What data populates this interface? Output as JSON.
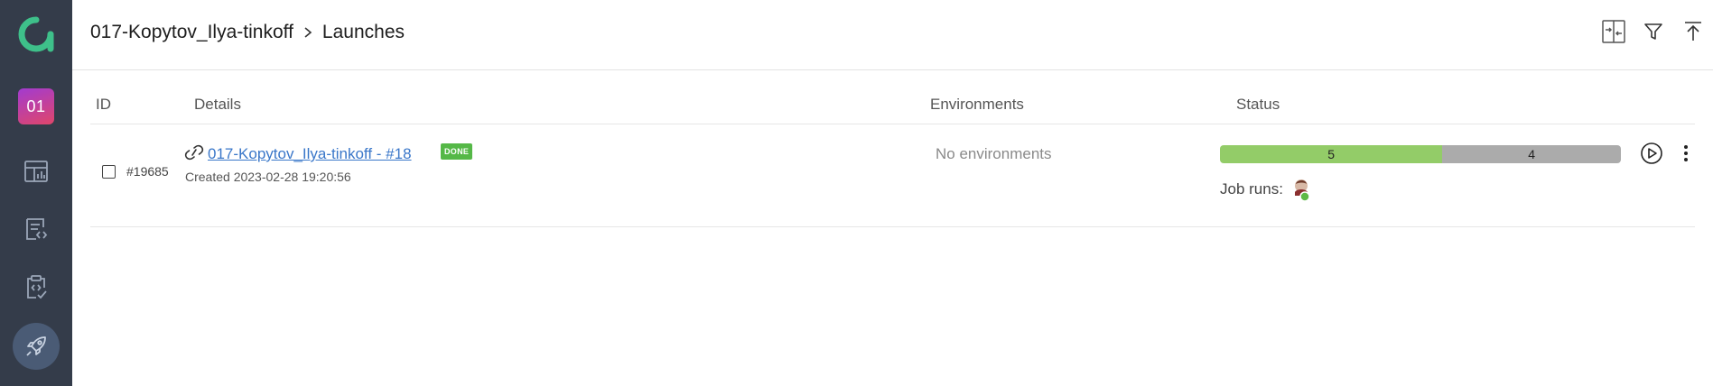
{
  "sidebar": {
    "logo_icon": "allure-logo-icon",
    "project_badge": "01",
    "items": [
      {
        "name": "dashboards",
        "icon": "dashboard-icon"
      },
      {
        "name": "test-cases",
        "icon": "test-cases-icon"
      },
      {
        "name": "test-plans",
        "icon": "clipboard-check-icon"
      },
      {
        "name": "launches",
        "icon": "rocket-icon",
        "active": true
      }
    ]
  },
  "header": {
    "breadcrumb": {
      "project": "017-Kopytov_Ilya-tinkoff",
      "page": "Launches"
    },
    "tools": [
      "merge-icon",
      "filter-icon",
      "upload-icon"
    ]
  },
  "table": {
    "columns": {
      "id": "ID",
      "details": "Details",
      "environments": "Environments",
      "status": "Status"
    },
    "rows": [
      {
        "id": "#19685",
        "name": "017-Kopytov_Ilya-tinkoff - #18",
        "badge": "DONE",
        "created": "Created 2023-02-28 19:20:56",
        "environments": "No environments",
        "status": {
          "passed": "5",
          "other": "4",
          "passed_fraction": 0.555
        },
        "job_runs_label": "Job runs:"
      }
    ]
  },
  "colors": {
    "sidebar_bg": "#343c4a",
    "passed": "#93cc68",
    "other": "#ababab",
    "done_badge": "#55b847",
    "link": "#3a77c9"
  }
}
